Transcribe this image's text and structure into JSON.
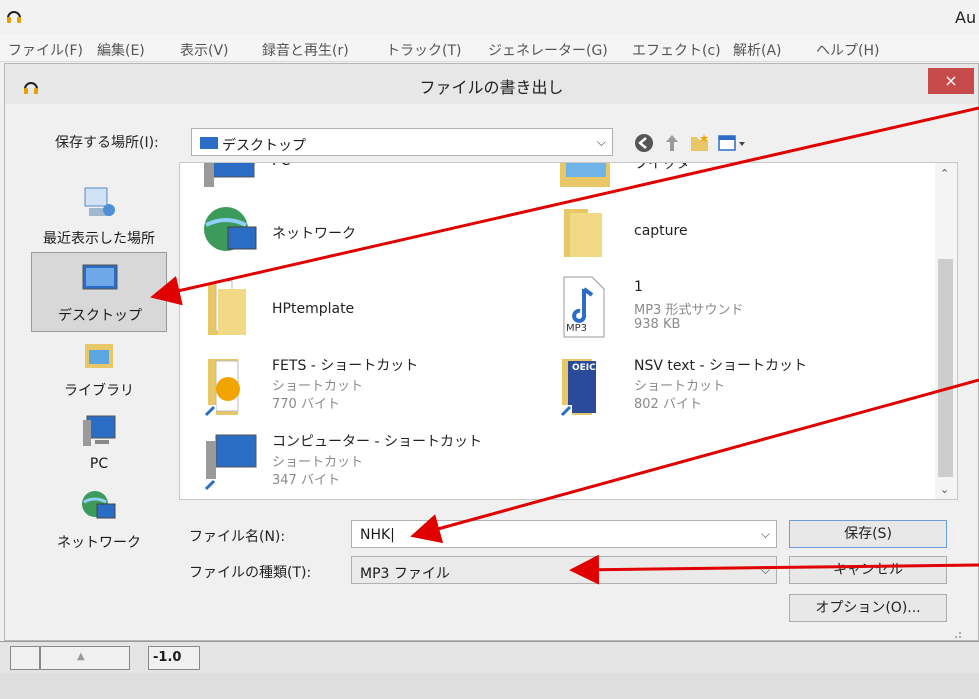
{
  "app": {
    "title": "Au"
  },
  "menu": [
    "ファイル(F)",
    "編集(E)",
    "表示(V)",
    "録音と再生(r)",
    "トラック(T)",
    "ジェネレーター(G)",
    "エフェクト(c)",
    "解析(A)",
    "ヘルプ(H)"
  ],
  "dialog": {
    "title": "ファイルの書き出し",
    "close": "×",
    "save_in_label": "保存する場所(I):",
    "save_in_value": "デスクトップ",
    "places": [
      "最近表示した場所",
      "デスクトップ",
      "ライブラリ",
      "PC",
      "ネットワーク"
    ],
    "files": [
      {
        "name": "PC"
      },
      {
        "name": "ツイッター"
      },
      {
        "name": "ネットワーク"
      },
      {
        "name": "capture"
      },
      {
        "name": "HPtemplate"
      },
      {
        "name": "1",
        "type": "MP3 形式サウンド",
        "size": "938 KB",
        "badge": "MP3"
      },
      {
        "name": "FETS - ショートカット",
        "type": "ショートカット",
        "size": "770 バイト"
      },
      {
        "name": "NSV text - ショートカット",
        "type": "ショートカット",
        "size": "802 バイト",
        "badge": "OEIC"
      },
      {
        "name": "コンピューター - ショートカット",
        "type": "ショートカット",
        "size": "347 バイト"
      }
    ],
    "filename_label": "ファイル名(N):",
    "filename_value": "NHK|",
    "filetype_label": "ファイルの種類(T):",
    "filetype_value": "MP3 ファイル",
    "save_button": "保存(S)",
    "cancel_button": "キャンセル",
    "options_button": "オプション(O)..."
  },
  "ruler": {
    "value": "-1.0"
  },
  "colors": {
    "close": "#c74a4a",
    "arrow": "#e00000",
    "folder": "#e8c766"
  }
}
